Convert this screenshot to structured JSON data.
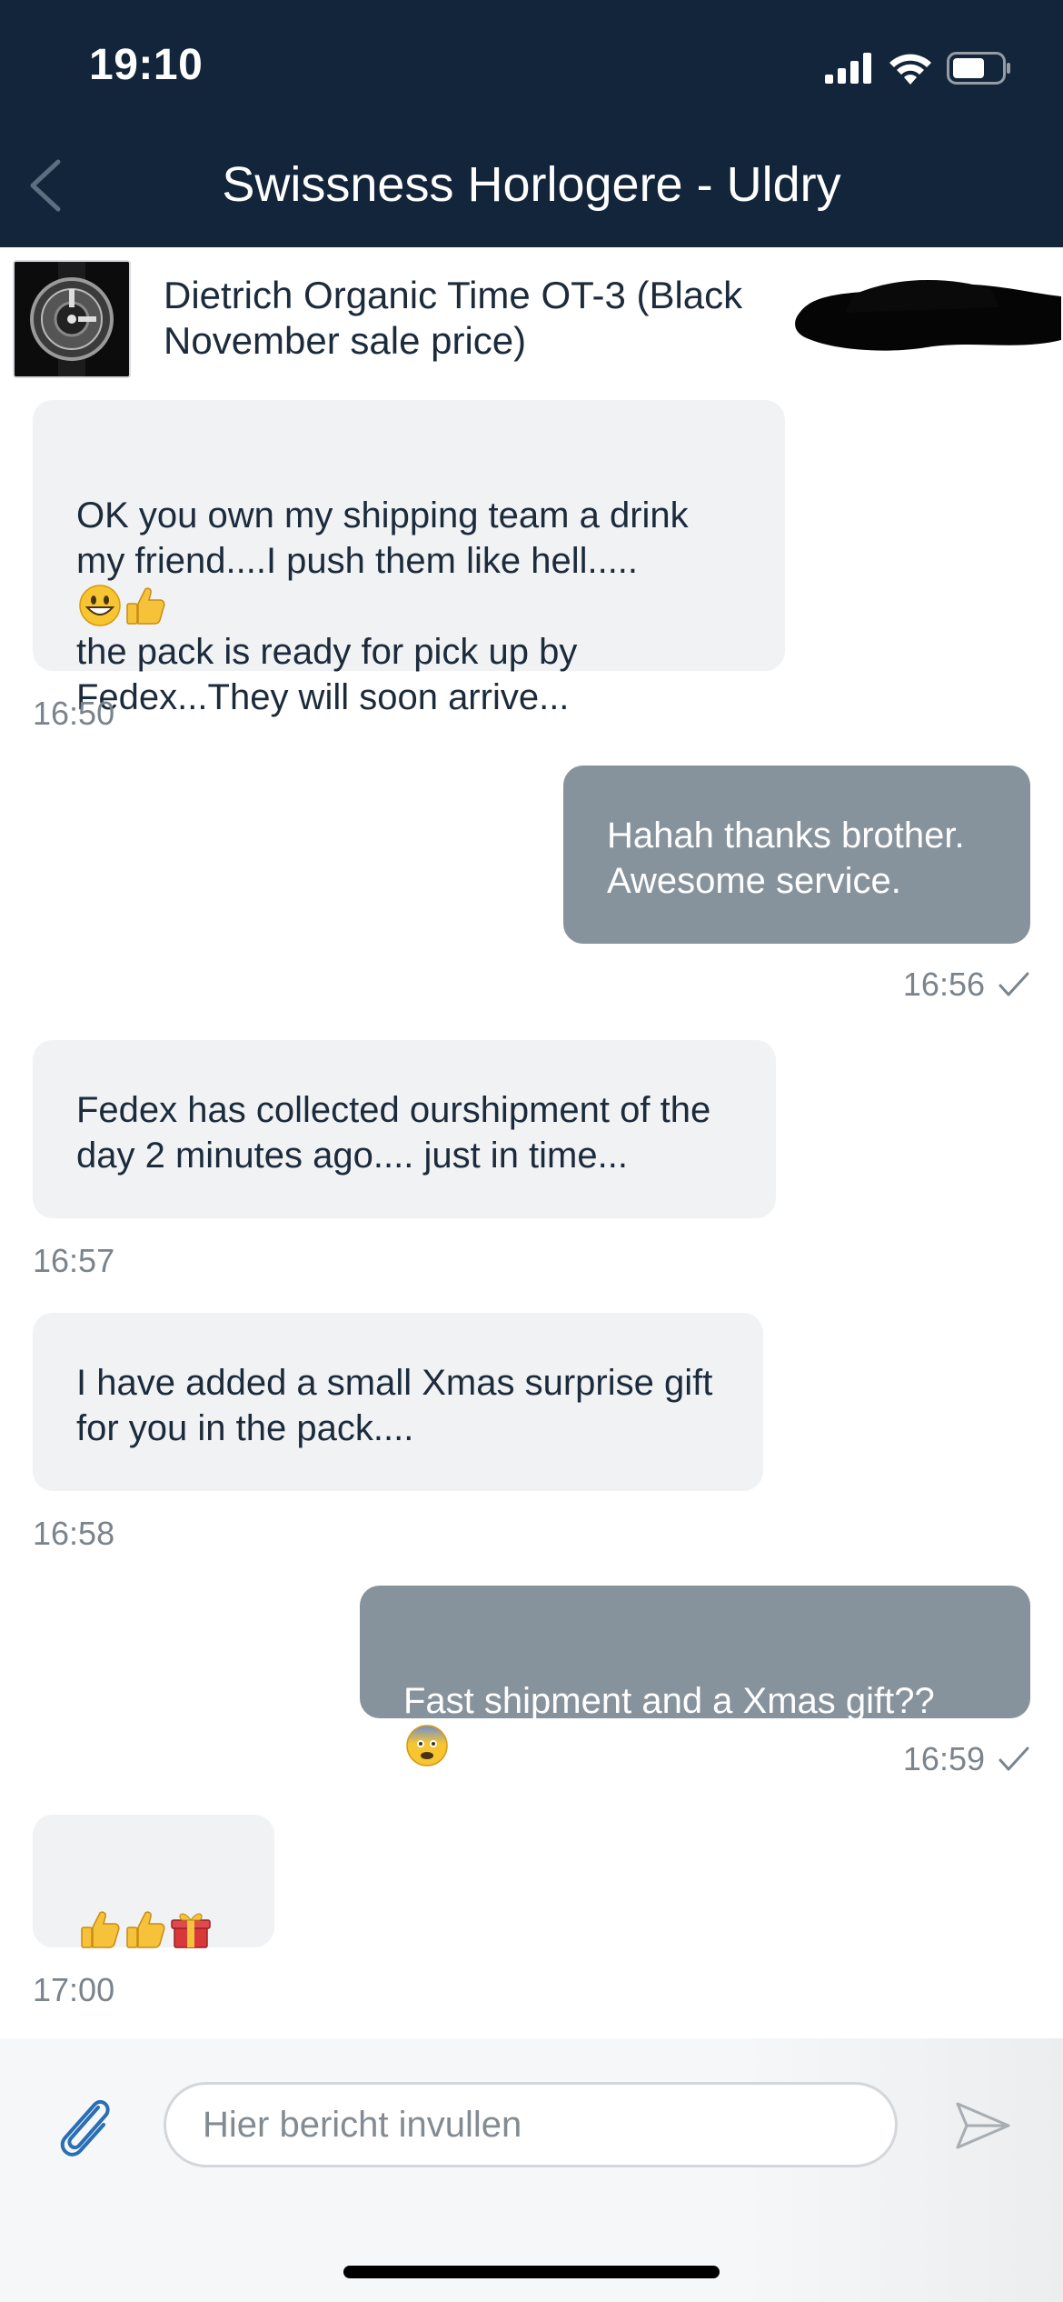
{
  "status_bar": {
    "time": "19:10",
    "icons": [
      "cellular-signal-icon",
      "wifi-icon",
      "battery-icon"
    ]
  },
  "header": {
    "back_icon": "chevron-left-icon",
    "title": "Swissness Horlogere - Uldry"
  },
  "product": {
    "title": "Dietrich Organic Time OT-3 (Black November sale price)",
    "thumbnail_icon": "watch-thumbnail"
  },
  "messages": [
    {
      "direction": "incoming",
      "text": "OK you own my shipping team a drink my friend....I push them like hell.....",
      "text_tail": "the pack is ready for pick up by Fedex...They will soon arrive...",
      "emojis": [
        "grinning-face-emoji",
        "thumbs-up-emoji"
      ],
      "time": "16:50"
    },
    {
      "direction": "outgoing",
      "text": "Hahah thanks brother.\nAwesome service.",
      "time": "16:56",
      "read_icon": "checkmark-icon"
    },
    {
      "direction": "incoming",
      "text": "Fedex has collected ourshipment of the day 2 minutes ago.... just in time...",
      "time": "16:57"
    },
    {
      "direction": "incoming",
      "text": "I have added a small Xmas surprise gift for you in the pack....",
      "time": "16:58"
    },
    {
      "direction": "outgoing",
      "text": "Fast shipment and a Xmas gift??",
      "emojis": [
        "anxious-face-emoji"
      ],
      "time": "16:59",
      "read_icon": "checkmark-icon"
    },
    {
      "direction": "incoming",
      "emojis": [
        "thumbs-up-emoji",
        "thumbs-up-emoji",
        "wrapped-gift-emoji"
      ],
      "time": "17:00"
    }
  ],
  "composer": {
    "attach_icon": "paperclip-icon",
    "placeholder": "Hier bericht invullen",
    "value": "",
    "send_icon": "send-icon"
  },
  "colors": {
    "header_bg": "#13253a",
    "incoming_bubble": "#f1f2f4",
    "outgoing_bubble": "#87939c",
    "timestamp": "#7b848c"
  }
}
